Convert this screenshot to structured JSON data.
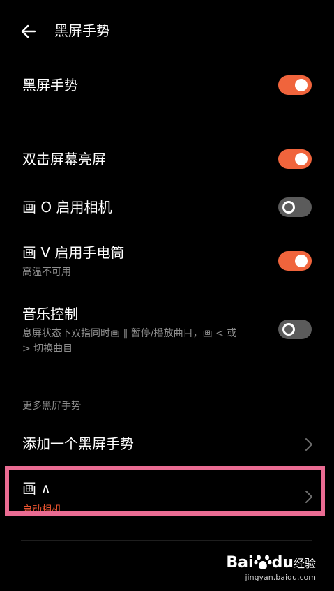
{
  "header": {
    "title": "黑屏手势"
  },
  "main_toggle": {
    "label": "黑屏手势",
    "on": true
  },
  "gestures": [
    {
      "label": "双击屏幕亮屏",
      "subtitle": "",
      "on": true
    },
    {
      "label": "画 O 启用相机",
      "subtitle": "",
      "on": false
    },
    {
      "label": "画 V 启用手电筒",
      "subtitle": "高温不可用",
      "on": true
    },
    {
      "label": "音乐控制",
      "subtitle_line1": "息屏状态下双指同时画 ‖ 暂停/播放曲目，画 < 或",
      "subtitle_line2": "> 切换曲目",
      "on": false
    }
  ],
  "more_section": {
    "label": "更多黑屏手势",
    "add_item": "添加一个黑屏手势",
    "custom_item": {
      "label": "画 ∧",
      "subtitle": "启动相机"
    }
  },
  "watermark": {
    "brand": "Bai",
    "brand2": "du",
    "suffix": "经验",
    "url": "jingyan.baidu.com"
  },
  "colors": {
    "accent": "#f0643c",
    "toggle_off": "#5b5b5b",
    "highlight": "#ea6c93",
    "subtitle_accent": "#e8532f"
  }
}
